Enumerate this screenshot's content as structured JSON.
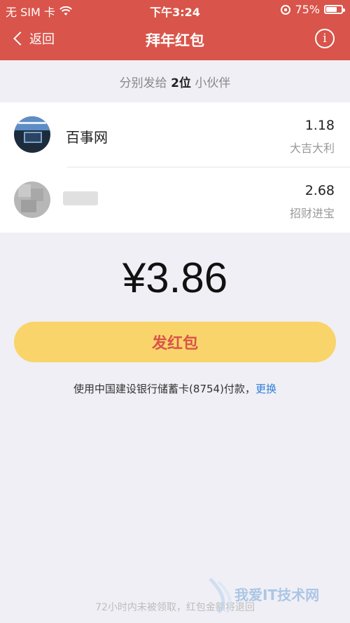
{
  "status_bar": {
    "carrier": "无 SIM 卡",
    "time": "下午3:24",
    "battery": "75%"
  },
  "nav": {
    "back_label": "返回",
    "title": "拜年红包"
  },
  "summary": {
    "prefix": "分别发给",
    "count": "2位",
    "suffix": "小伙伴"
  },
  "recipients": [
    {
      "name": "百事网",
      "amount": "1.18",
      "blessing": "大吉大利"
    },
    {
      "name": "",
      "amount": "2.68",
      "blessing": "招财进宝"
    }
  ],
  "total": "¥3.86",
  "send_button_label": "发红包",
  "payment": {
    "text": "使用中国建设银行储蓄卡(8754)付款，",
    "change_label": "更换"
  },
  "footer_note": "72小时内未被领取，红包金额将退回",
  "watermark_text": "我爱IT技术网",
  "colors": {
    "header": "#d9544a",
    "button": "#f9d46a",
    "button_text": "#d9544a",
    "link": "#2f7fd6"
  }
}
